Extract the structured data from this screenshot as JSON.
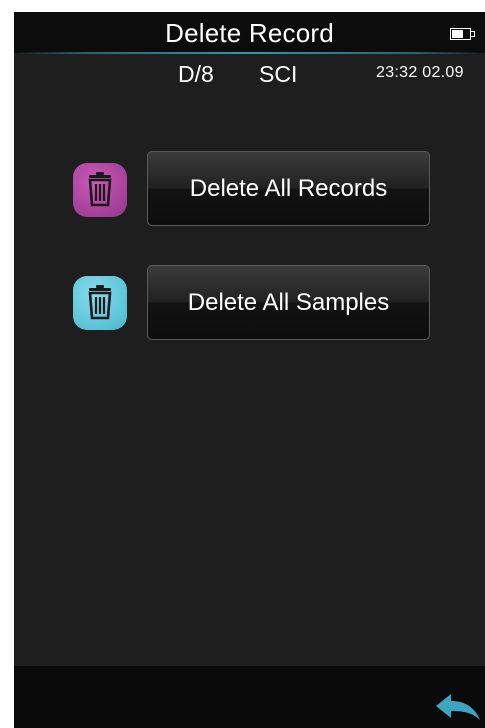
{
  "header": {
    "title": "Delete Record",
    "battery_icon": "battery-icon"
  },
  "status": {
    "geometry": "D/8",
    "mode": "SCI",
    "time_date": "23:32  02.09"
  },
  "actions": [
    {
      "label": "Delete All Records",
      "icon": "trash-icon",
      "icon_color": "#a6409a"
    },
    {
      "label": "Delete All Samples",
      "icon": "trash-icon",
      "icon_color": "#5bc4d9"
    }
  ],
  "footer": {
    "back_icon": "back-arrow-icon",
    "accent_color": "#3aa6bf"
  },
  "colors": {
    "background": "#1e1e1e",
    "title_accent": "#2f98ac"
  }
}
